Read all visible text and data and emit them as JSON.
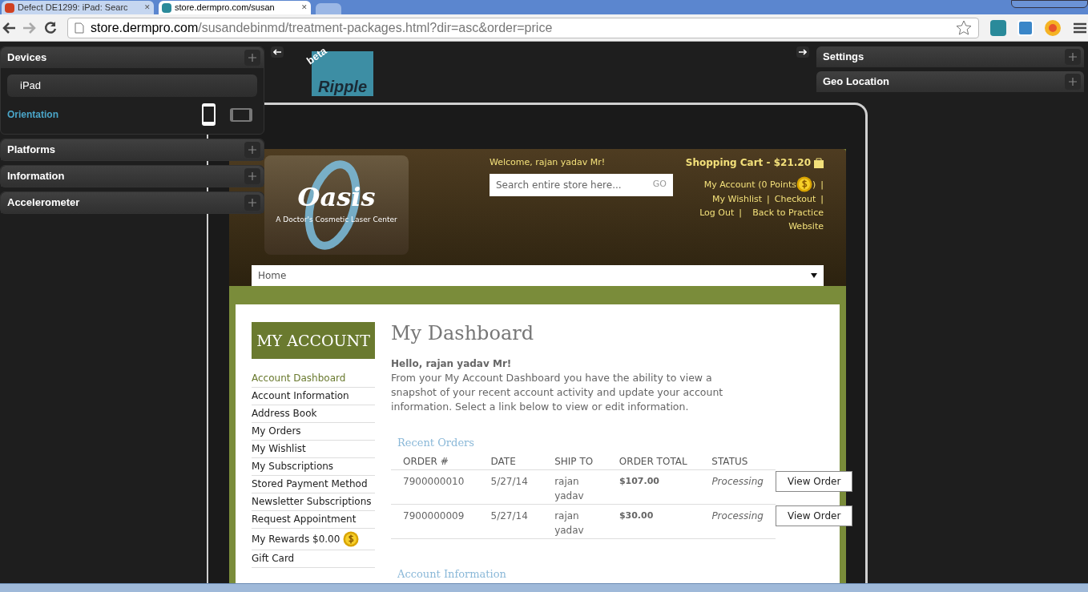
{
  "browser": {
    "tabs": [
      {
        "title": "Defect DE1299: iPad: Searc",
        "selected": false,
        "close": "✕"
      },
      {
        "title": "store.dermpro.com/susan",
        "selected": true,
        "close": "✕"
      }
    ],
    "address": {
      "host": "store.dermpro.com",
      "path": "/susandebinmd/treatment-packages.html?dir=asc&order=price"
    }
  },
  "left_panels": [
    {
      "title": "Devices",
      "expanded": true
    },
    {
      "title": "Platforms",
      "expanded": false
    },
    {
      "title": "Information",
      "expanded": false
    },
    {
      "title": "Accelerometer",
      "expanded": false
    }
  ],
  "devices": {
    "device": "iPad",
    "orientation_label": "Orientation",
    "orientations": [
      {
        "kind": "portrait",
        "selected": true
      },
      {
        "kind": "landscape",
        "selected": false
      }
    ]
  },
  "right_panels": [
    {
      "title": "Settings"
    },
    {
      "title": "Geo Location"
    }
  ],
  "logo": {
    "name": "Ripple",
    "badge": "beta"
  },
  "store": {
    "brand": "Oasis",
    "tagline": "A Doctor's Cosmetic Laser Center",
    "welcome": "Welcome, rajan yadav Mr!",
    "search": {
      "placeholder": "Search entire store here...",
      "button": "GO"
    },
    "cart": "Shopping Cart - $21.20",
    "account_link": {
      "label": "My Account (0 Points",
      "close": ")"
    },
    "separator": "|",
    "links": [
      "My Wishlist",
      "Checkout",
      "Log Out",
      "Back to Practice Website"
    ],
    "nav": {
      "value": "Home"
    }
  },
  "sidebar": {
    "title": "MY ACCOUNT",
    "items": [
      {
        "label": "Account Dashboard",
        "selected": true,
        "coin": false
      },
      {
        "label": "Account Information",
        "selected": false,
        "coin": false
      },
      {
        "label": "Address Book",
        "selected": false,
        "coin": false
      },
      {
        "label": "My Orders",
        "selected": false,
        "coin": false
      },
      {
        "label": "My Wishlist",
        "selected": false,
        "coin": false
      },
      {
        "label": "My Subscriptions",
        "selected": false,
        "coin": false
      },
      {
        "label": "Stored Payment Method",
        "selected": false,
        "coin": false
      },
      {
        "label": "Newsletter Subscriptions",
        "selected": false,
        "coin": false
      },
      {
        "label": "Request Appointment",
        "selected": false,
        "coin": false
      },
      {
        "label": "My Rewards $0.00",
        "selected": false,
        "coin": true
      },
      {
        "label": "Gift Card",
        "selected": false,
        "coin": false
      }
    ]
  },
  "dashboard": {
    "title": "My Dashboard",
    "greeting": "Hello, rajan yadav Mr!",
    "intro": "From your My Account Dashboard you have the ability to view a snapshot of your recent account activity and update your account information. Select a link below to view or edit information.",
    "recent_orders": {
      "heading": "Recent Orders",
      "columns": [
        "ORDER #",
        "DATE",
        "SHIP TO",
        "ORDER TOTAL",
        "STATUS"
      ],
      "rows": [
        {
          "order": "7900000010",
          "date": "5/27/14",
          "ship_to": "rajan yadav",
          "total": "$107.00",
          "status": "Processing",
          "action": "View Order"
        },
        {
          "order": "7900000009",
          "date": "5/27/14",
          "ship_to": "rajan yadav",
          "total": "$30.00",
          "status": "Processing",
          "action": "View Order"
        }
      ]
    },
    "next_heading": "Account Information"
  }
}
